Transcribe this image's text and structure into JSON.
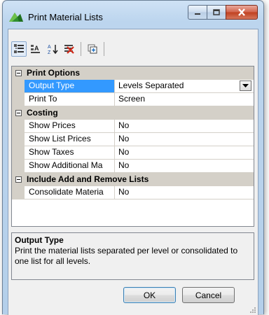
{
  "window": {
    "title": "Print Material Lists"
  },
  "toolbar": {
    "buttons": [
      {
        "name": "categorized-view-button",
        "icon": "categorized-icon",
        "pressed": true
      },
      {
        "name": "alphabetical-group-button",
        "icon": "alpha-group-icon",
        "pressed": false
      },
      {
        "name": "sort-alphabetical-button",
        "icon": "sort-az-icon",
        "pressed": false
      },
      {
        "name": "property-pages-button",
        "icon": "property-pages-icon",
        "pressed": false
      },
      {
        "name": "expand-button",
        "icon": "expand-icon",
        "pressed": false
      }
    ]
  },
  "grid": {
    "categories": [
      {
        "label": "Print Options",
        "rows": [
          {
            "name": "Output Type",
            "value": "Levels Separated",
            "selected": true,
            "dropdown": true
          },
          {
            "name": "Print To",
            "value": "Screen"
          }
        ]
      },
      {
        "label": "Costing",
        "rows": [
          {
            "name": "Show Prices",
            "value": "No"
          },
          {
            "name": "Show List Prices",
            "value": "No"
          },
          {
            "name": "Show Taxes",
            "value": "No"
          },
          {
            "name": "Show Additional Ma",
            "value": "No"
          }
        ]
      },
      {
        "label": "Include Add and Remove Lists",
        "rows": [
          {
            "name": "Consolidate Materia",
            "value": "No"
          }
        ]
      }
    ]
  },
  "description": {
    "title": "Output Type",
    "text": "Print the material lists separated per level or consolidated to one list for all levels."
  },
  "buttons": {
    "ok": "OK",
    "cancel": "Cancel"
  },
  "colors": {
    "selection": "#3399ff",
    "category_bg": "#d4d0c8",
    "client_bg": "#f0f0f0"
  }
}
